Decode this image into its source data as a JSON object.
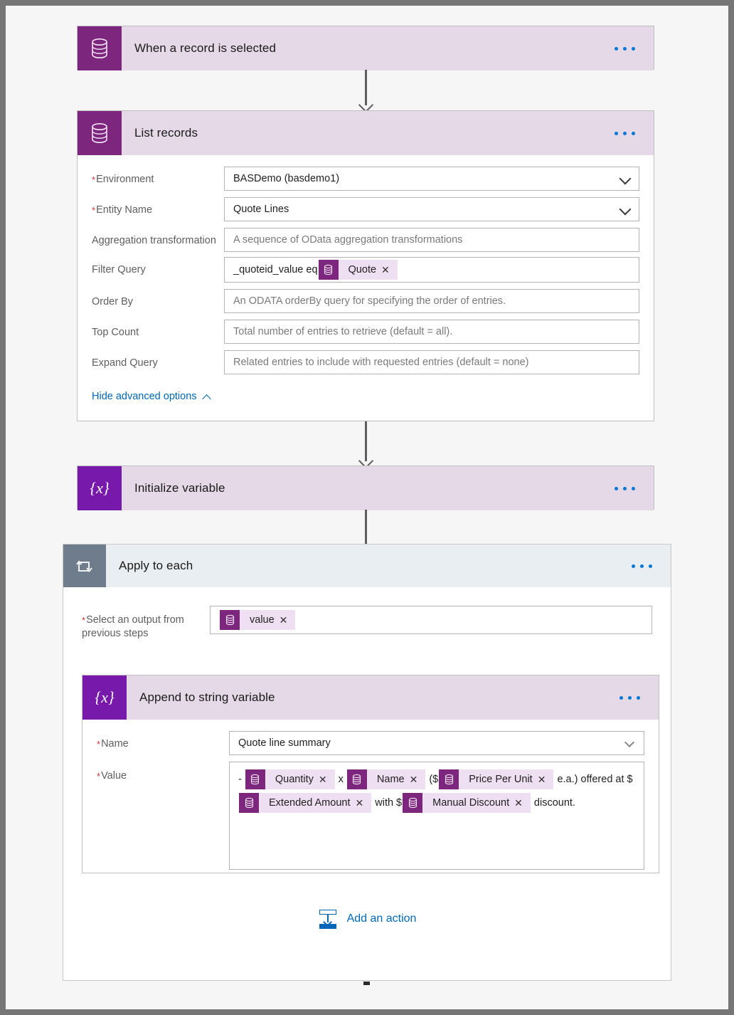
{
  "flow": {
    "steps": [
      {
        "id": "trigger",
        "title": "When a record is selected",
        "icon": "database-icon",
        "menu_label": "More commands"
      },
      {
        "id": "list-records",
        "title": "List records",
        "icon": "database-icon",
        "menu_label": "More commands",
        "fields": [
          {
            "label": "Environment",
            "required": true,
            "value": "BASDemo (basdemo1)",
            "placeholder": "",
            "control": "dropdown"
          },
          {
            "label": "Entity Name",
            "required": true,
            "value": "Quote Lines",
            "placeholder": "",
            "control": "dropdown"
          },
          {
            "label": "Aggregation transformation",
            "required": false,
            "value": "",
            "placeholder": "A sequence of OData aggregation transformations",
            "control": "text"
          },
          {
            "label": "Filter Query",
            "required": false,
            "value": "_quoteid_value eq ",
            "placeholder": "",
            "control": "token-text",
            "token": {
              "label": "Quote",
              "close": "✕",
              "icon": "database-icon"
            }
          },
          {
            "label": "Order By",
            "required": false,
            "value": "",
            "placeholder": "An ODATA orderBy query for specifying the order of entries.",
            "control": "text"
          },
          {
            "label": "Top Count",
            "required": false,
            "value": "",
            "placeholder": "Total number of entries to retrieve (default = all).",
            "control": "text"
          },
          {
            "label": "Expand Query",
            "required": false,
            "value": "",
            "placeholder": "Related entries to include with requested entries (default = none)",
            "control": "text"
          }
        ],
        "advanced_options_label": "Hide advanced options"
      },
      {
        "id": "initialize-variable",
        "title": "Initialize variable",
        "icon": "variable-icon",
        "icon_glyph": "{x}",
        "menu_label": "More commands"
      }
    ],
    "loop": {
      "id": "apply-to-each",
      "title": "Apply to each",
      "icon": "loop-icon",
      "menu_label": "More commands",
      "select_output": {
        "label": "Select an output from previous steps",
        "required": true,
        "token": {
          "label": "value",
          "close": "✕",
          "icon": "database-icon"
        }
      },
      "inner_step": {
        "id": "append-to-string-variable",
        "title": "Append to string variable",
        "icon": "variable-icon",
        "icon_glyph": "{x}",
        "menu_label": "More commands",
        "name_field": {
          "label": "Name",
          "required": true,
          "value": "Quote line summary",
          "control": "dropdown"
        },
        "value_field": {
          "label": "Value",
          "required": true,
          "parts": [
            {
              "type": "text",
              "text": "- "
            },
            {
              "type": "token",
              "label": "Quantity",
              "close": "✕",
              "icon": "database-icon"
            },
            {
              "type": "text",
              "text": " x "
            },
            {
              "type": "token",
              "label": "Name",
              "close": "✕",
              "icon": "database-icon"
            },
            {
              "type": "text",
              "text": " ($"
            },
            {
              "type": "token",
              "label": "Price Per Unit",
              "close": "✕",
              "icon": "database-icon"
            },
            {
              "type": "text",
              "text": " e.a.) offered at $"
            },
            {
              "type": "token",
              "label": "Extended Amount",
              "close": "✕",
              "icon": "database-icon"
            },
            {
              "type": "text",
              "text": " with $"
            },
            {
              "type": "token",
              "label": "Manual Discount",
              "close": "✕",
              "icon": "database-icon"
            },
            {
              "type": "text",
              "text": " discount."
            }
          ]
        }
      },
      "add_action_label": "Add an action"
    }
  },
  "colors": {
    "connector_purple": "#7D267D",
    "variable_purple": "#7719AA",
    "loop_slate": "#6E7C8C",
    "card_header_lavender": "#E5D9E8",
    "loop_header_blue": "#E9EEF2",
    "link_blue": "#0067B8",
    "ellipsis_blue": "#0078D4",
    "required_red": "#D13438",
    "canvas_bg": "#F6F6F6",
    "token_bg": "#EFDFF2"
  }
}
